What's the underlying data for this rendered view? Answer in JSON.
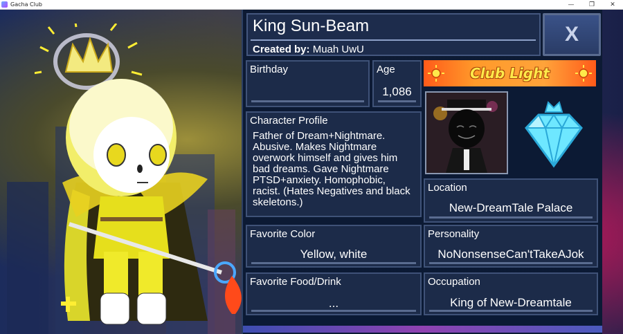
{
  "window": {
    "title": "Gacha Club",
    "controls": [
      "—",
      "❐",
      "✕"
    ]
  },
  "profile": {
    "name": "King Sun-Beam",
    "created_by_label": "Created by:",
    "created_by_value": "Muah UwU",
    "close_label": "X",
    "birthday": {
      "label": "Birthday",
      "value": ""
    },
    "age": {
      "label": "Age",
      "value": "1,086"
    },
    "character_profile": {
      "label": "Character Profile",
      "value": "Father of Dream+Nightmare. Abusive. Makes Nightmare overwork himself and gives him bad dreams. Gave Nightmare PTSD+anxiety. Homophobic, racist. (Hates Negatives and black skeletons.)"
    },
    "location": {
      "label": "Location",
      "value": "New-DreamTale Palace"
    },
    "favorite_color": {
      "label": "Favorite Color",
      "value": "Yellow, white"
    },
    "personality": {
      "label": "Personality",
      "value": "NoNonsenseCan'tTakeAJok"
    },
    "favorite_food": {
      "label": "Favorite Food/Drink",
      "value": "..."
    },
    "occupation": {
      "label": "Occupation",
      "value": "King of New-Dreamtale"
    }
  },
  "club": {
    "title": "Club Light"
  },
  "icons": {
    "app": "gacha-club-app-icon",
    "close": "close-icon",
    "sun": "sun-icon",
    "diamond": "diamond-crown-icon"
  },
  "colors": {
    "panel": "#0d1a33",
    "field": "#1c2b49",
    "banner": "#ff9a2a",
    "diamond": "#6ee7ff"
  }
}
